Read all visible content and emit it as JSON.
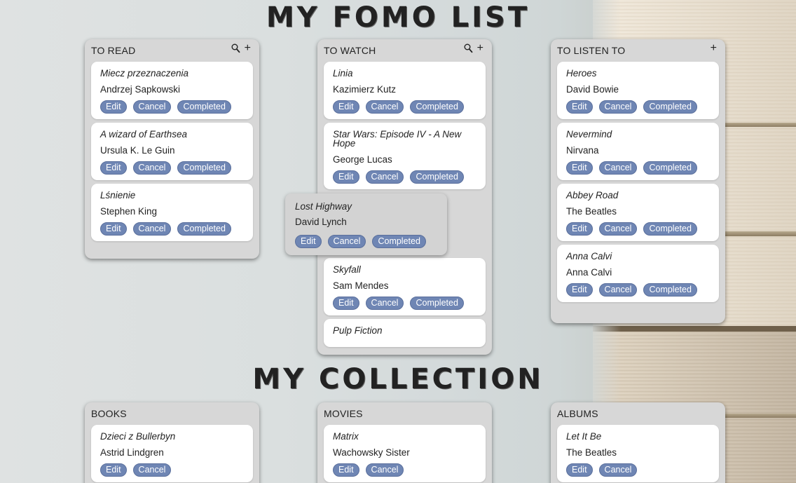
{
  "titles": {
    "fomo": "My FOMO List",
    "collection": "My Collection"
  },
  "buttons": {
    "edit": "Edit",
    "cancel": "Cancel",
    "completed": "Completed"
  },
  "icons": {
    "search": "search-icon",
    "add": "+"
  },
  "fomo": {
    "to_read": {
      "header": "TO READ",
      "items": [
        {
          "title": "Miecz przeznaczenia",
          "author": "Andrzej Sapkowski"
        },
        {
          "title": "A wizard of Earthsea",
          "author": "Ursula K. Le Guin"
        },
        {
          "title": "Lśnienie",
          "author": "Stephen King"
        }
      ]
    },
    "to_watch": {
      "header": "TO WATCH",
      "items": [
        {
          "title": "Linia",
          "author": "Kazimierz Kutz"
        },
        {
          "title": "Star Wars: Episode IV - A New Hope",
          "author": "George Lucas"
        },
        {
          "title": "Skyfall",
          "author": "Sam Mendes"
        },
        {
          "title": "Pulp Fiction",
          "author": ""
        }
      ],
      "dragging": {
        "title": "Lost Highway",
        "author": "David Lynch"
      }
    },
    "to_listen": {
      "header": "TO LISTEN TO",
      "items": [
        {
          "title": "Heroes",
          "author": "David Bowie"
        },
        {
          "title": "Nevermind",
          "author": "Nirvana"
        },
        {
          "title": "Abbey Road",
          "author": "The Beatles"
        },
        {
          "title": "Anna Calvi",
          "author": "Anna Calvi"
        }
      ]
    }
  },
  "collection": {
    "books": {
      "header": "BOOKS",
      "items": [
        {
          "title": "Dzieci z Bullerbyn",
          "author": "Astrid Lindgren"
        }
      ]
    },
    "movies": {
      "header": "MOVIES",
      "items": [
        {
          "title": "Matrix",
          "author": "Wachowsky Sister"
        }
      ]
    },
    "albums": {
      "header": "ALBUMS",
      "items": [
        {
          "title": "Let It Be",
          "author": "The Beatles"
        }
      ]
    }
  }
}
